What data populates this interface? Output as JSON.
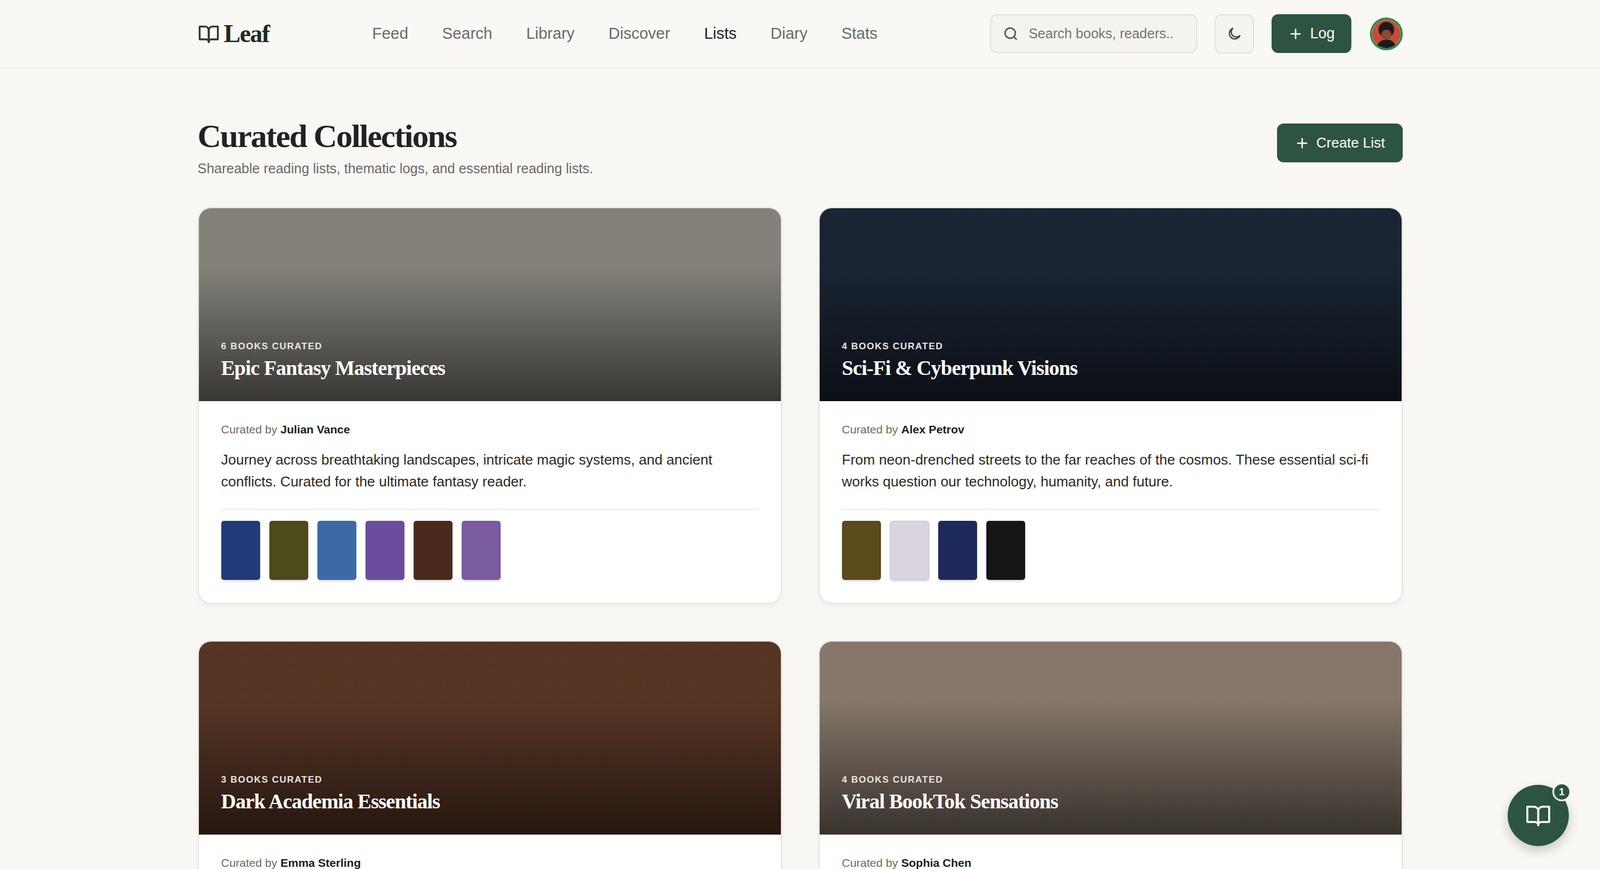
{
  "brand": {
    "name": "Leaf"
  },
  "nav": [
    {
      "label": "Feed",
      "selected": false
    },
    {
      "label": "Search",
      "selected": false
    },
    {
      "label": "Library",
      "selected": false
    },
    {
      "label": "Discover",
      "selected": false
    },
    {
      "label": "Lists",
      "selected": true
    },
    {
      "label": "Diary",
      "selected": false
    },
    {
      "label": "Stats",
      "selected": false
    }
  ],
  "search": {
    "placeholder": "Search books, readers.."
  },
  "log_button": "Log",
  "page": {
    "title": "Curated Collections",
    "subtitle": "Shareable reading lists, thematic logs, and essential reading lists.",
    "create_button": "Create List"
  },
  "lists": [
    {
      "count": "6 BOOKS CURATED",
      "title": "Epic Fantasy Masterpieces",
      "curated_by_label": "Curated by",
      "curator": "Julian Vance",
      "description": "Journey across breathtaking landscapes, intricate magic systems, and ancient conflicts. Curated for the ultimate fantasy reader.",
      "color": "#8a8880",
      "covers": [
        {
          "color": "#233a78"
        },
        {
          "color": "#4d4a1c"
        },
        {
          "color": "#3c6aa6"
        },
        {
          "color": "#6c4c9c"
        },
        {
          "color": "#4a2a1e"
        },
        {
          "color": "#7a5aa0"
        }
      ]
    },
    {
      "count": "4 BOOKS CURATED",
      "title": "Sci-Fi & Cyberpunk Visions",
      "curated_by_label": "Curated by",
      "curator": "Alex Petrov",
      "description": "From neon-drenched streets to the far reaches of the cosmos. These essential sci-fi works question our technology, humanity, and future.",
      "color": "#1c2636",
      "covers": [
        {
          "color": "#5a4a1c"
        },
        {
          "color": "#d9d4de"
        },
        {
          "color": "#1e2a5c"
        },
        {
          "color": "#151515"
        }
      ]
    },
    {
      "count": "3 BOOKS CURATED",
      "title": "Dark Academia Essentials",
      "curated_by_label": "Curated by",
      "curator": "Emma Sterling",
      "color": "#5c3826",
      "covers": []
    },
    {
      "count": "4 BOOKS CURATED",
      "title": "Viral BookTok Sensations",
      "curated_by_label": "Curated by",
      "curator": "Sophia Chen",
      "color": "#8c7d70",
      "covers": []
    }
  ],
  "reader_badge": "1"
}
